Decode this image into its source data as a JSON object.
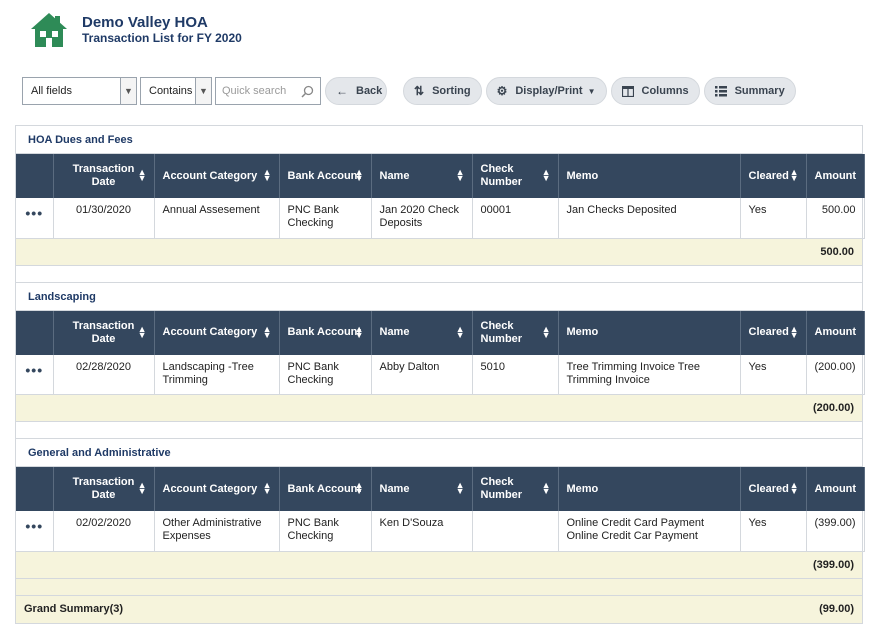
{
  "header": {
    "title": "Demo Valley HOA",
    "subtitle": "Transaction List for FY 2020"
  },
  "toolbar": {
    "field_select": "All fields",
    "operator_select": "Contains",
    "search_placeholder": "Quick search",
    "back": "Back",
    "sorting": "Sorting",
    "display_print": "Display/Print",
    "columns": "Columns",
    "summary": "Summary"
  },
  "columns": [
    "Transaction Date",
    "Account Category",
    "Bank Account",
    "Name",
    "Check Number",
    "Memo",
    "Cleared",
    "Amount"
  ],
  "groups": [
    {
      "title": "HOA Dues and Fees",
      "row": {
        "date": "01/30/2020",
        "category": "Annual Assesement",
        "bank": "PNC Bank Checking",
        "name": "Jan 2020 Check Deposits",
        "check": "00001",
        "memo": "Jan Checks Deposited",
        "cleared": "Yes",
        "amount": "500.00"
      },
      "subtotal": "500.00"
    },
    {
      "title": "Landscaping",
      "row": {
        "date": "02/28/2020",
        "category": "Landscaping -Tree Trimming",
        "bank": "PNC Bank Checking",
        "name": "Abby Dalton",
        "check": "5010",
        "memo": "Tree Trimming Invoice Tree Trimming Invoice",
        "cleared": "Yes",
        "amount": "(200.00)"
      },
      "subtotal": "(200.00)"
    },
    {
      "title": "General and Administrative",
      "row": {
        "date": "02/02/2020",
        "category": "Other Administrative Expenses",
        "bank": "PNC Bank Checking",
        "name": "Ken D'Souza",
        "check": "",
        "memo": "Online Credit Card Payment Online Credit Car Payment",
        "cleared": "Yes",
        "amount": "(399.00)"
      },
      "subtotal": "(399.00)"
    }
  ],
  "grand_summary": {
    "label": "Grand Summary(3)",
    "amount": "(99.00)"
  },
  "colors": {
    "header_bg": "#34475e",
    "title": "#1f3a66",
    "logo": "#2e8b57",
    "subtotal_bg": "#f6f4dc"
  },
  "icons": {
    "logo": "house-logo-icon",
    "search": "search-icon",
    "back": "arrow-left-icon",
    "sorting": "sort-icon",
    "display": "gear-icon",
    "columns": "columns-icon",
    "summary": "list-icon",
    "row_menu": "ellipsis-icon"
  }
}
